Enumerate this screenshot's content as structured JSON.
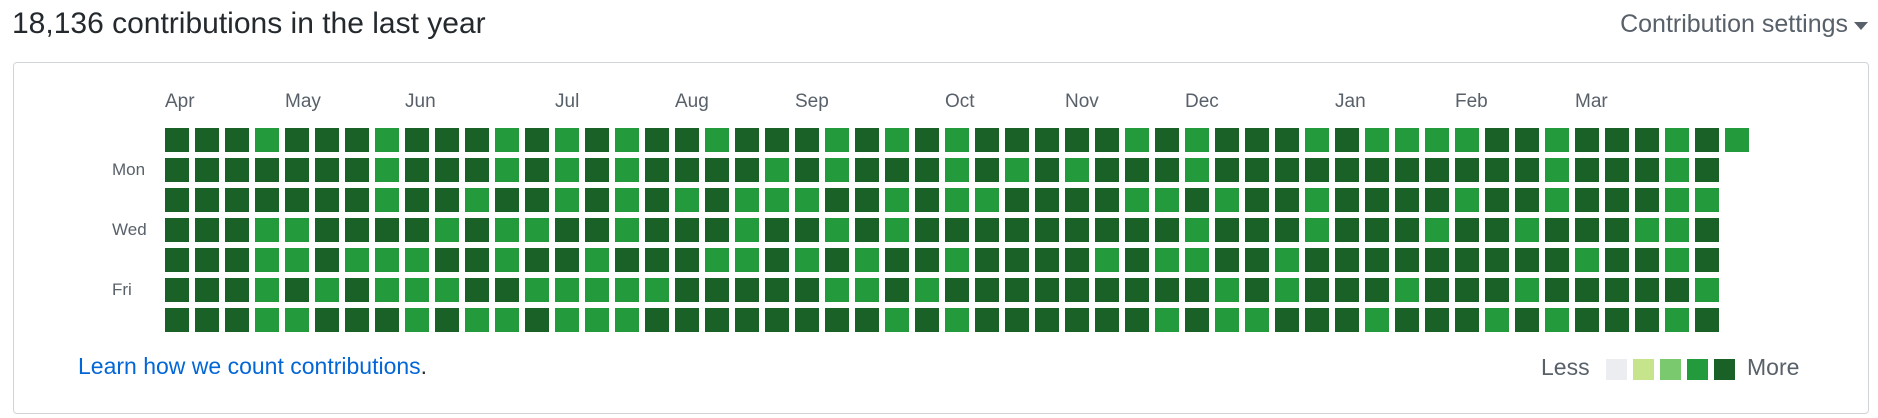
{
  "header": {
    "title": "18,136 contributions in the last year",
    "settings_label": "Contribution settings"
  },
  "calendar": {
    "months": [
      {
        "label": "Apr",
        "col": 0
      },
      {
        "label": "May",
        "col": 4
      },
      {
        "label": "Jun",
        "col": 8
      },
      {
        "label": "Jul",
        "col": 13
      },
      {
        "label": "Aug",
        "col": 17
      },
      {
        "label": "Sep",
        "col": 21
      },
      {
        "label": "Oct",
        "col": 26
      },
      {
        "label": "Nov",
        "col": 30
      },
      {
        "label": "Dec",
        "col": 34
      },
      {
        "label": "Jan",
        "col": 39
      },
      {
        "label": "Feb",
        "col": 43
      },
      {
        "label": "Mar",
        "col": 47
      }
    ],
    "day_labels": [
      {
        "label": "Mon",
        "row": 1
      },
      {
        "label": "Wed",
        "row": 3
      },
      {
        "label": "Fri",
        "row": 5
      }
    ],
    "weeks": 53,
    "days_in_last_week": 1,
    "levels": [
      "DDDGDDDGDDDGDGDGDDGDDDGDGDGDDDDDGDGDDDGDGGGGDDGDDDGDG",
      "DDDDDDDGDDDGDGDGDDDDGDGDDDGDGDGDDDGDDDDDDDDDDDGDDDGDD",
      "DDDDDDDGDDGDDGDGDGDGGGDDGDGGDDDDGGDGDDGDDDDGDDGDDDGGD",
      "DDDGGDDDDGDGGDDGDDDGDDGDGDDDDDDDDDGDDDGDDDGDDGDDDGGDG",
      "DDDGGDGGGDDGDDGDDDGGDGDGDDGDDDDGDGGDDGDDDDDDDDDGDDGDD",
      "DDDGDGDGGGDDGGGGGDDDDDGGDGDDDDDDDDDGDGDDDGDDDGDDDDDGD",
      "DDDGGDDDGDGGDGGGDDDDDDDDGDGDDDDDDGDGGDDDGDDDGDGDDDGDG"
    ],
    "level_colors": {
      "0": "#ebedf0",
      "1": "#c6e48b",
      "2": "#7bc96f",
      "3": "#239a3b",
      "4": "#196127"
    }
  },
  "footer": {
    "link_text": "Learn how we count contributions",
    "period": ".",
    "legend_less": "Less",
    "legend_more": "More"
  }
}
